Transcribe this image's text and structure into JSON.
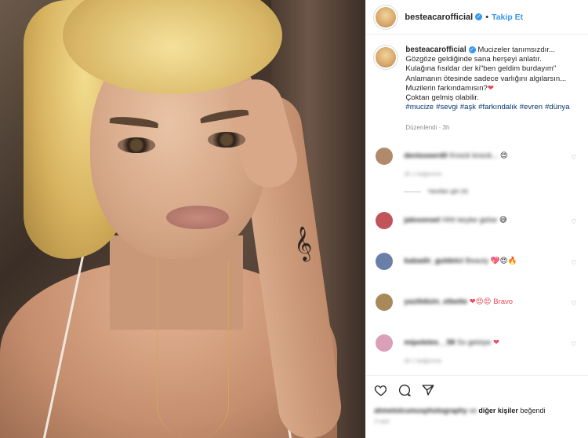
{
  "header": {
    "username": "besteacarofficial",
    "separator": "•",
    "follow_label": "Takip Et"
  },
  "caption": {
    "username": "besteacarofficial",
    "lines": [
      "Mucizeler tanımsızdır...",
      "Gözgöze geldiğinde sana herşeyi anlatır.",
      "Kulağına fısıldar der ki\"ben geldim burdayım\"",
      "Anlamanın ötesinde sadece varlığını algılarsın...",
      "Muzilerin farkındamısın?",
      "Çoktan gelmiş olabilir."
    ],
    "heart": "❤",
    "hashtags": [
      "#mucize",
      "#sevgi",
      "#aşk",
      "#farkındalık",
      "#evren",
      "#dünya"
    ],
    "meta": "Düzenlendi · 3h"
  },
  "comments": [
    {
      "user": "denisseerdil",
      "text": "Knock knock...",
      "emoji": "😍",
      "meta": "3h   1 beğenme",
      "replies": "Yanıtları gör (4)",
      "avatar_color": "#b08a6a"
    },
    {
      "user": "jalesonsel",
      "text": "Hhh keyke gelse",
      "emoji": "😅",
      "avatar_color": "#c0545a"
    },
    {
      "user": "babadir_guldelci",
      "text": "Beauty",
      "emoji": "💖😍🔥",
      "avatar_color": "#6a7fa8"
    },
    {
      "user": "yazilidizin_elbette",
      "text": "",
      "emoji": "❤😍😍 Bravo",
      "avatar_color": "#a88a5a"
    },
    {
      "user": "mipoleles__58",
      "text": "Ss gelsiye",
      "emoji": "❤",
      "meta": "3h   1 beğenme",
      "avatar_color": "#d9a0b8"
    }
  ],
  "actions": {
    "icons": [
      "heart-outline-icon",
      "comment-icon",
      "share-icon"
    ],
    "likes_user": "ahmetolcumusphotography",
    "likes_mid": " ve ",
    "likes_rest": "diğer kişiler",
    "likes_end": " beğendi",
    "time": "3 saat"
  },
  "colors": {
    "accent": "#3897f0",
    "hashtag": "#003569",
    "muted": "#8e8e8e",
    "heart": "#ed4956"
  }
}
